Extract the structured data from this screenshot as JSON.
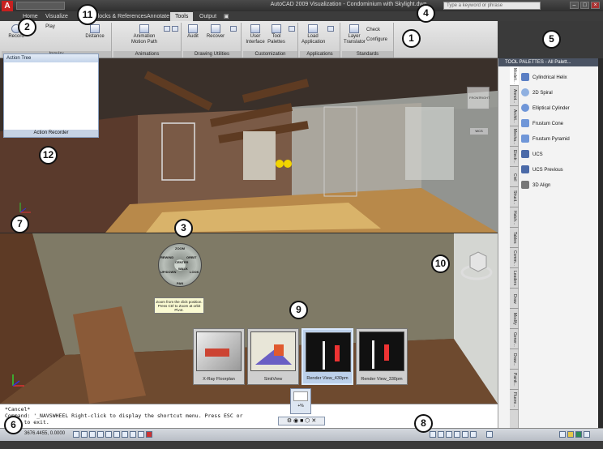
{
  "window": {
    "title": "AutoCAD 2009 Visualization - Condominium with Skylight.dwg",
    "search_placeholder": "Type a keyword or phrase",
    "app_letter": "A"
  },
  "ribbon_tabs": [
    "Home",
    "Visualize",
    "Blocks & References",
    "Annotate",
    "Tools",
    "Output",
    "▣"
  ],
  "active_tab": "Tools",
  "ribbon": {
    "panels": [
      {
        "label": "Inquiry",
        "buttons": [
          "Record",
          "Play",
          "Distance"
        ]
      },
      {
        "label": "Animations",
        "buttons": [
          "Animation Motion Path"
        ]
      },
      {
        "label": "Drawing Utilities",
        "buttons": [
          "Audit",
          "Recover"
        ]
      },
      {
        "label": "Customization",
        "buttons": [
          "User Interface",
          "Tool Palettes"
        ]
      },
      {
        "label": "Applications",
        "buttons": [
          "Load Application"
        ]
      },
      {
        "label": "Standards",
        "buttons": [
          "Layer Translator",
          "Check",
          "Configure"
        ]
      }
    ]
  },
  "action_tree": {
    "header": "Action Tree",
    "footer": "Action Recorder"
  },
  "palette": {
    "header": "TOOL PALETTES - All Palett...",
    "tabs": [
      "Modeli...",
      "Annot...",
      "Archit...",
      "Mecha...",
      "Electr...",
      "Civil",
      "Struct...",
      "Hatch...",
      "Tables",
      "Comm...",
      "Leaders",
      "Draw",
      "Modify",
      "Gener...",
      "Draw...",
      "Painti...",
      "Fluore..."
    ],
    "items": [
      {
        "label": "Cylindrical Helix",
        "color": "#5b7fc4"
      },
      {
        "label": "2D Spiral",
        "color": "#8fb0e0"
      },
      {
        "label": "Elliptical Cylinder",
        "color": "#6f96d8"
      },
      {
        "label": "Frustum Cone",
        "color": "#6f96d8"
      },
      {
        "label": "Frustum Pyramid",
        "color": "#6f96d8"
      },
      {
        "label": "UCS",
        "color": "#4b6aa8"
      },
      {
        "label": "UCS Previous",
        "color": "#4b6aa8"
      },
      {
        "label": "3D Align",
        "color": "#777"
      }
    ]
  },
  "viewport_top": {
    "viewcube_labels": [
      "FRONT",
      "RIGHT",
      "WCS"
    ]
  },
  "steering_wheel": {
    "sectors": [
      "ZOOM",
      "ORBIT",
      "PAN",
      "REWIND",
      "CENTER",
      "WALK",
      "LOOK",
      "UP/DOWN"
    ],
    "tooltip": "Zoom from the click position. Press Ctrl to Zoom at orbit Pivot."
  },
  "views": [
    {
      "caption": "X-Ray Floorplan"
    },
    {
      "caption": "SinkView"
    },
    {
      "caption": "Render View_430pm"
    },
    {
      "caption": "Render View_330pm"
    }
  ],
  "command_lines": [
    "*Cancel*",
    "Command: '_NAVSWHEEL Right-click to display the shortcut menu. Press ESC or",
    "ENTER to exit."
  ],
  "status": {
    "coords": "3676.4455, 0.0000",
    "thumb_label": "+%"
  },
  "callouts": [
    "1",
    "2",
    "3",
    "4",
    "5",
    "6",
    "7",
    "8",
    "9",
    "10",
    "11",
    "12"
  ]
}
